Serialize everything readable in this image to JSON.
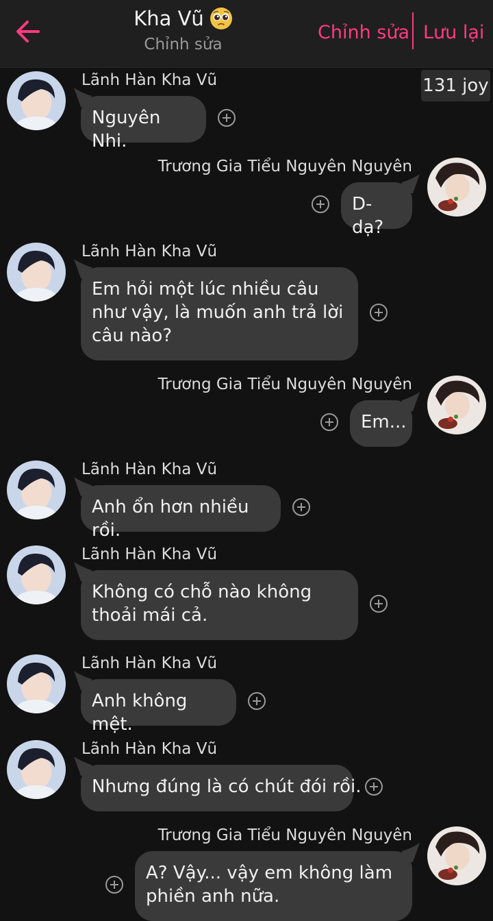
{
  "header": {
    "title": "Kha Vũ",
    "title_emoji": "pleading-face-emoji",
    "subtitle": "Chỉnh sửa",
    "edit_label": "Chỉnh sửa",
    "save_label": "Lưu lại",
    "back_icon": "arrow-left-icon",
    "accent_color": "#ff3b7f"
  },
  "joy_badge": "131 joy",
  "messages": [
    {
      "side": "left",
      "sender": "Lãnh Hàn Kha Vũ",
      "text": "Nguyên Nhi."
    },
    {
      "side": "right",
      "sender": "Trương Gia Tiểu Nguyên Nguyên",
      "text": "D-dạ?"
    },
    {
      "side": "left",
      "sender": "Lãnh Hàn Kha Vũ",
      "text": "Em hỏi một lúc nhiều câu như vậy, là muốn anh trả lời câu nào?"
    },
    {
      "side": "right",
      "sender": "Trương Gia Tiểu Nguyên Nguyên",
      "text": "Em..."
    },
    {
      "side": "left",
      "sender": "Lãnh Hàn Kha Vũ",
      "text": "Anh ổn hơn nhiều rồi."
    },
    {
      "side": "left",
      "sender": "Lãnh Hàn Kha Vũ",
      "text": "Không có chỗ nào không thoải mái cả."
    },
    {
      "side": "left",
      "sender": "Lãnh Hàn Kha Vũ",
      "text": "Anh không mệt."
    },
    {
      "side": "left",
      "sender": "Lãnh Hàn Kha Vũ",
      "text": "Nhưng đúng là có chút đói rồi."
    },
    {
      "side": "right",
      "sender": "Trương Gia Tiểu Nguyên Nguyên",
      "text": "A? Vậy... vậy em không làm phiền anh nữa."
    }
  ],
  "colors": {
    "background": "#121212",
    "bubble": "#3a3a3a",
    "header_bg": "#1f1f1f"
  }
}
